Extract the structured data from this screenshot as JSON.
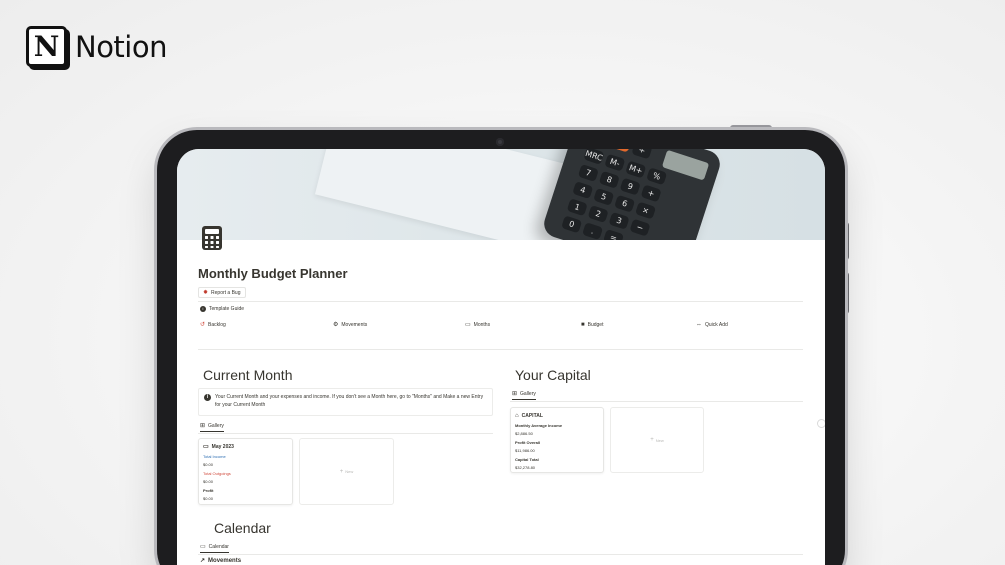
{
  "brand": {
    "logo_letter": "N",
    "name": "Notion"
  },
  "page": {
    "icon": "calculator-icon",
    "title": "Monthly Budget Planner",
    "report_bug_label": "Report a Bug",
    "template_guide_label": "Template Guide"
  },
  "nav": {
    "items": [
      {
        "label": "Backlog",
        "icon": "undo-icon"
      },
      {
        "label": "Movements",
        "icon": "gear-icon"
      },
      {
        "label": "Months",
        "icon": "calendar-icon"
      },
      {
        "label": "Budget",
        "icon": "lock-icon"
      },
      {
        "label": "Quick Add",
        "icon": "arrow-icon"
      }
    ]
  },
  "current_month": {
    "heading": "Current Month",
    "callout": "Your Current Month and your expenses and income. If you don't see a Month here, go to \"Months\" and Make a new Entry for your Current Month",
    "view_tab": "Gallery",
    "card": {
      "title": "May 2023",
      "total_income_label": "Total Income",
      "total_income_value": "$0.00",
      "total_outgoings_label": "Total Outgoings",
      "total_outgoings_value": "$0.00",
      "profit_label": "Profit",
      "profit_value": "$0.00"
    },
    "new_label": "New"
  },
  "capital": {
    "heading": "Your Capital",
    "view_tab": "Gallery",
    "card": {
      "title": "CAPITAL",
      "monthly_avg_label": "Monthly Average Income",
      "monthly_avg_value": "$2,886.50",
      "profit_overall_label": "Profit Overall",
      "profit_overall_value": "$11,986.00",
      "capital_total_label": "Capital Total",
      "capital_total_value": "$32,278.80"
    },
    "new_label": "New"
  },
  "calendar": {
    "heading": "Calendar",
    "view_tab": "Calendar",
    "next_section": "Movements"
  },
  "colors": {
    "heading_highlight": "#a9d4dd",
    "text": "#37352f",
    "income_blue": "#2f6fb3",
    "outgoing_red": "#d04a3c"
  }
}
